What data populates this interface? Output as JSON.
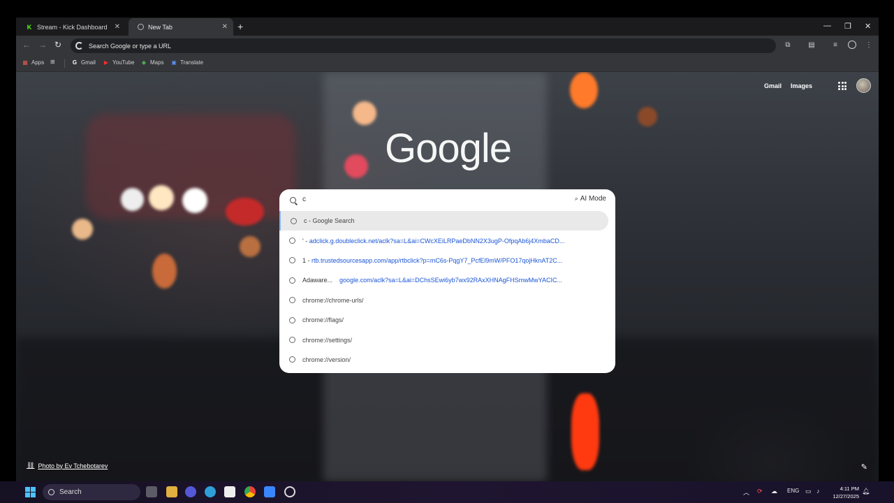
{
  "tabs": [
    {
      "title": "Stream - Kick Dashboard",
      "icon": "kick-icon"
    },
    {
      "title": "New Tab",
      "icon": "chrome-icon"
    }
  ],
  "omnibox": {
    "placeholder": "Search Google or type a URL"
  },
  "bookmarks": [
    {
      "label": "Apps",
      "icon": "apps-grid-icon"
    },
    {
      "label": "Gmail",
      "icon": "google-icon"
    },
    {
      "label": "YouTube",
      "icon": "youtube-icon"
    },
    {
      "label": "Maps",
      "icon": "maps-icon"
    },
    {
      "label": "Translate",
      "icon": "translate-icon"
    }
  ],
  "page_links": {
    "gmail": "Gmail",
    "images": "Images"
  },
  "logo_text": "Google",
  "search": {
    "query": "c",
    "ai_mode": "AI Mode",
    "suggestions": [
      {
        "type": "search",
        "text": "c - Google Search"
      },
      {
        "type": "url",
        "title": "' -",
        "url": "adclick.g.doubleclick.net/aclk?sa=L&ai=CWcXEiLRPaeDbNN2X3ugP-OfpqAb6j4XmbaCD..."
      },
      {
        "type": "url",
        "title": "1 -",
        "url": "rtb.trustedsourcesapp.com/app/rtbclick?p=mC6s-PqgY7_PcfEl9mW/PFO17qojHknAT2C..."
      },
      {
        "type": "url",
        "title": "Adaware...",
        "url": "google.com/aclk?sa=L&ai=DChsSEwi6yb7wx92RAxXHNAgFHSmwMwYACIC..."
      },
      {
        "type": "history",
        "text": "chrome://chrome-urls/"
      },
      {
        "type": "history",
        "text": "chrome://flags/"
      },
      {
        "type": "history",
        "text": "chrome://settings/"
      },
      {
        "type": "history",
        "text": "chrome://version/"
      }
    ]
  },
  "photo_credit": "Photo by Ev Tchebotarev",
  "taskbar": {
    "search_label": "Search",
    "language": "ENG",
    "time": "4:11 PM",
    "date": "12/27/2025"
  },
  "colors": {
    "accent": "#4cc2ff",
    "link": "#1a55d6",
    "kick": "#53fc18"
  }
}
